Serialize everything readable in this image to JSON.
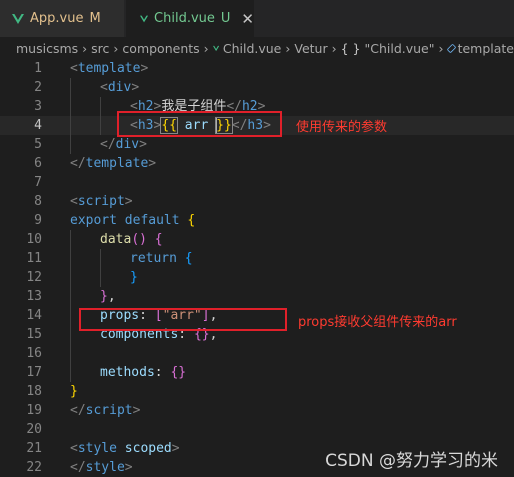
{
  "tabs": [
    {
      "label": "App.vue",
      "status": "M",
      "close": "",
      "active": false
    },
    {
      "label": "Child.vue",
      "status": "U",
      "close": "✕",
      "active": true
    }
  ],
  "breadcrumb": {
    "items": [
      "musicsms",
      "src",
      "components",
      "Child.vue",
      "Vetur",
      "\"Child.vue\"",
      "template"
    ],
    "braces": "{ }",
    "separator": "›"
  },
  "editor": {
    "line_numbers": [
      "1",
      "2",
      "3",
      "4",
      "5",
      "6",
      "7",
      "8",
      "9",
      "10",
      "11",
      "12",
      "13",
      "14",
      "15",
      "16",
      "17",
      "18",
      "19",
      "20",
      "21",
      "22"
    ],
    "current_line": 4,
    "tokens": {
      "template_tag": "template",
      "div_tag": "div",
      "h2_tag": "h2",
      "h2_text": "我是子组件",
      "h3_tag": "h3",
      "interp_open": "{{",
      "interp_var": "arr",
      "interp_close": "}}",
      "script_tag": "script",
      "export_kw": "export",
      "default_kw": "default",
      "data_fn": "data",
      "return_kw": "return",
      "props_key": "props",
      "props_value": "\"arr\"",
      "components_key": "components",
      "methods_key": "methods",
      "style_tag": "style",
      "scoped_attr": "scoped"
    }
  },
  "annotations": [
    {
      "text": "使用传来的参数",
      "color": "#e0202a"
    },
    {
      "text": "props接收父组件传来的arr",
      "color": "#e0202a"
    }
  ],
  "watermark": "CSDN @努力学习的米"
}
